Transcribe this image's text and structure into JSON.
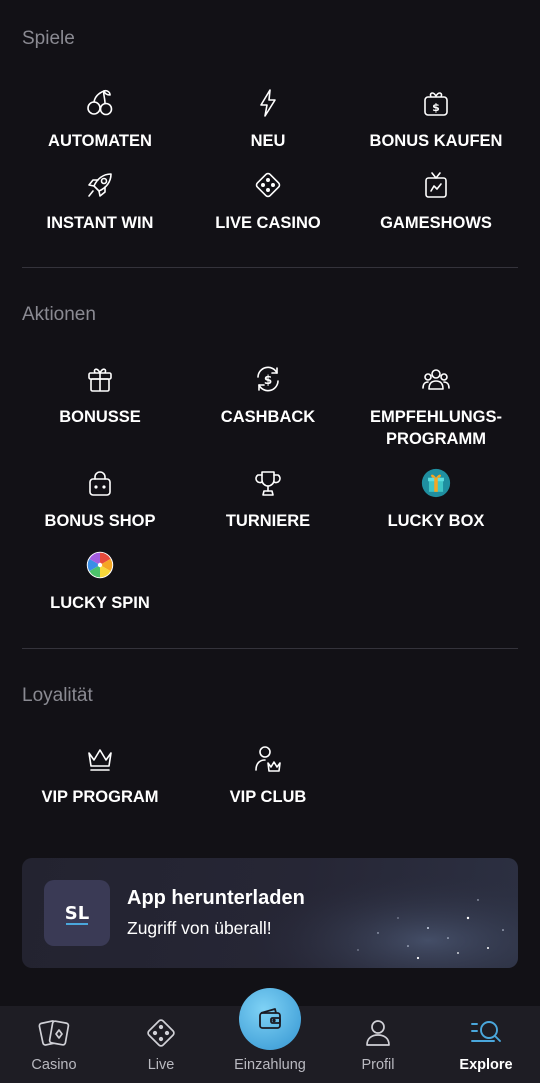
{
  "sections": {
    "games": {
      "title": "Spiele",
      "items": [
        {
          "label": "AUTOMATEN",
          "icon": "cherries-icon"
        },
        {
          "label": "NEU",
          "icon": "lightning-icon"
        },
        {
          "label": "BONUS KAUFEN",
          "icon": "gift-dollar-icon"
        },
        {
          "label": "INSTANT WIN",
          "icon": "rocket-icon"
        },
        {
          "label": "LIVE CASINO",
          "icon": "dice-icon"
        },
        {
          "label": "GAMESHOWS",
          "icon": "tv-icon"
        }
      ]
    },
    "promotions": {
      "title": "Aktionen",
      "items": [
        {
          "label": "BONUSSE",
          "icon": "gift-icon"
        },
        {
          "label": "CASHBACK",
          "icon": "cashback-icon"
        },
        {
          "label": "EMPFEHLUNGS-\nPROGRAMM",
          "icon": "people-icon"
        },
        {
          "label": "BONUS SHOP",
          "icon": "shopping-bag-icon"
        },
        {
          "label": "TURNIERE",
          "icon": "trophy-icon"
        },
        {
          "label": "LUCKY BOX",
          "icon": "lucky-box-icon"
        },
        {
          "label": "LUCKY SPIN",
          "icon": "lucky-spin-icon"
        }
      ]
    },
    "loyalty": {
      "title": "Loyalität",
      "items": [
        {
          "label": "VIP PROGRAM",
          "icon": "crown-icon"
        },
        {
          "label": "VIP CLUB",
          "icon": "user-crown-icon"
        }
      ]
    }
  },
  "banner": {
    "title": "App herunterladen",
    "subtitle": "Zugriff von überall!",
    "logo_text": "SL"
  },
  "bottom_nav": {
    "items": [
      {
        "label": "Casino",
        "icon": "cards-icon"
      },
      {
        "label": "Live",
        "icon": "dice-icon"
      },
      {
        "label": "Einzahlung",
        "icon": "wallet-icon"
      },
      {
        "label": "Profil",
        "icon": "user-icon"
      },
      {
        "label": "Explore",
        "icon": "search-list-icon"
      }
    ],
    "active": "Explore"
  },
  "colors": {
    "background": "#121116",
    "nav_background": "#1e1d24",
    "accent": "#4aa7dc",
    "section_title": "#8a8a92",
    "divider": "#34333b"
  }
}
